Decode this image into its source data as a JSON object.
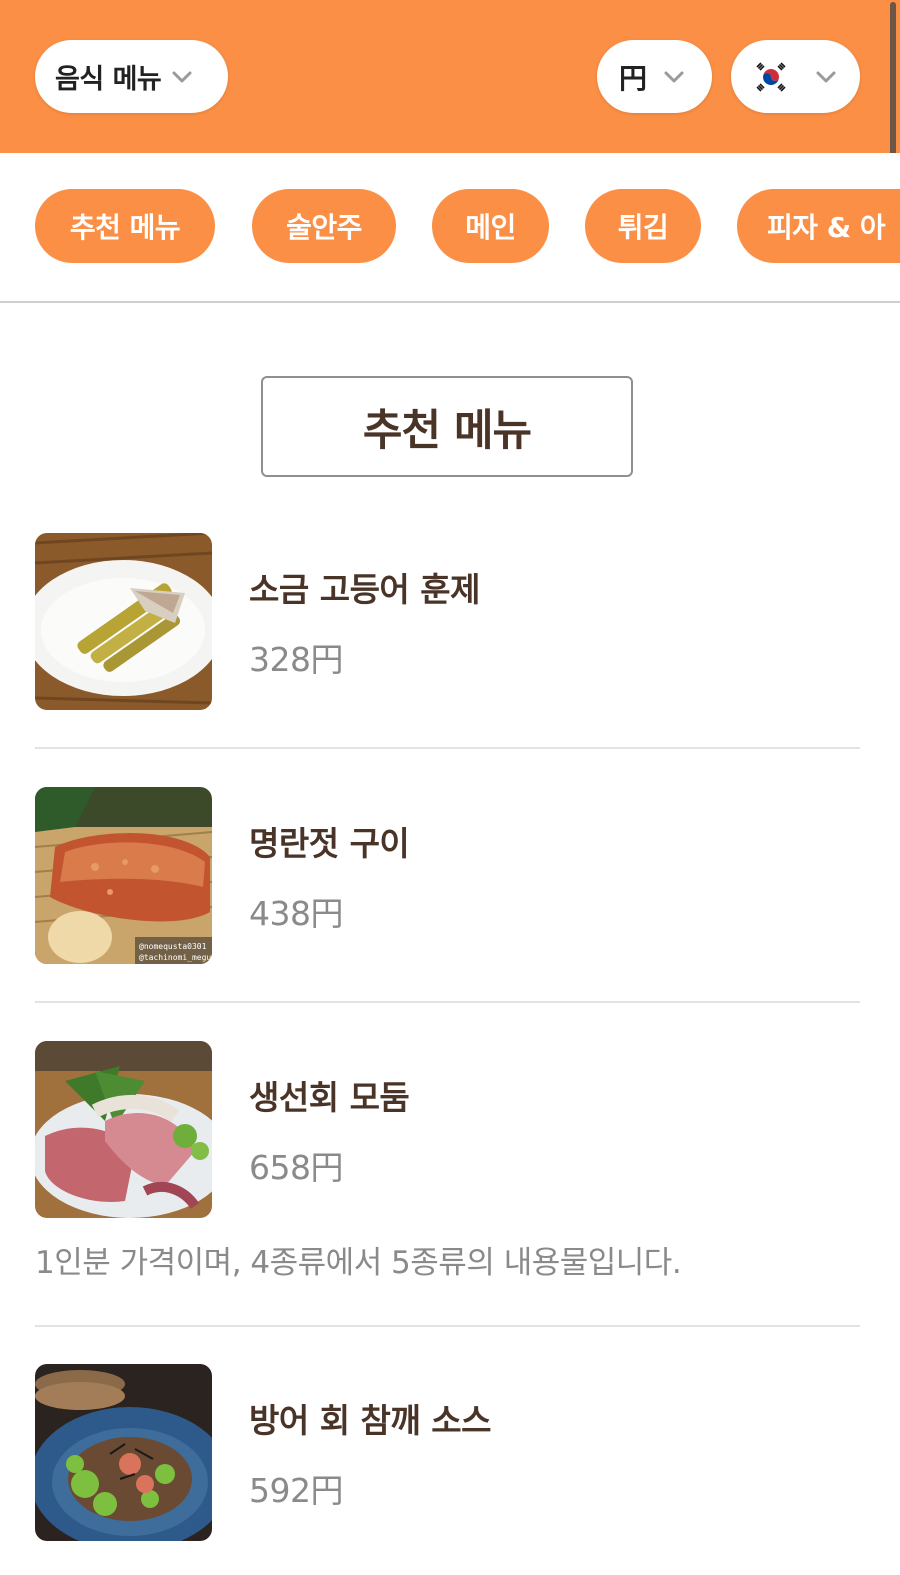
{
  "header": {
    "menu_selector": {
      "label": "음식 메뉴",
      "icon": "chevron-down-icon"
    },
    "currency_selector": {
      "label": "円",
      "icon": "chevron-down-icon"
    },
    "language_selector": {
      "flag": "korea-flag-icon",
      "icon": "chevron-down-icon"
    },
    "accent_color": "#fb8f45"
  },
  "categories": [
    {
      "label": "추천 메뉴"
    },
    {
      "label": "술안주"
    },
    {
      "label": "메인"
    },
    {
      "label": "튀김"
    },
    {
      "label": "피자 & 아"
    }
  ],
  "section": {
    "title": "추천 메뉴"
  },
  "items": [
    {
      "name": "소금 고등어 훈제",
      "price": "328円",
      "image": "smoked-mackerel-photo"
    },
    {
      "name": "명란젓 구이",
      "price": "438円",
      "image": "grilled-mentaiko-photo",
      "image_watermark": [
        "@nomequsta0301",
        "@tachinomi_meguro"
      ]
    },
    {
      "name": "생선회 모둠",
      "price": "658円",
      "image": "sashimi-platter-photo",
      "description": "1인분 가격이며, 4종류에서 5종류의 내용물입니다."
    },
    {
      "name": "방어 회 참깨 소스",
      "price": "592円",
      "image": "yellowtail-sesame-photo"
    }
  ]
}
